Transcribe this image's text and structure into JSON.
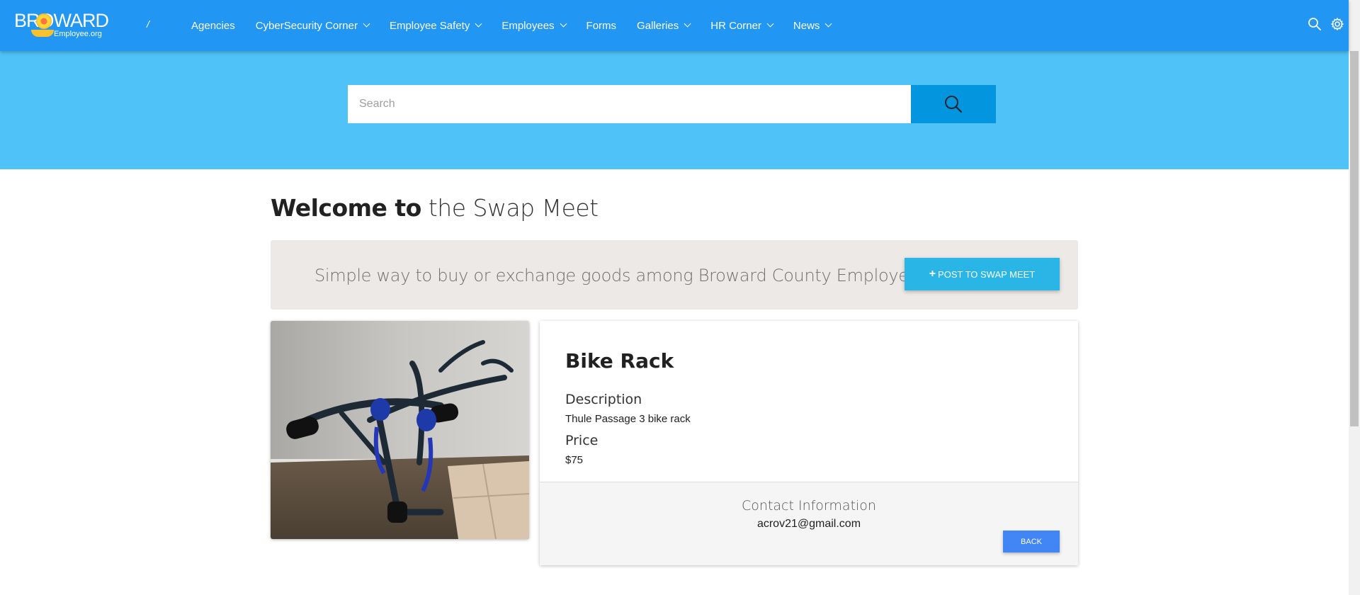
{
  "header": {
    "logo_text": "BROWARD",
    "logo_subtext": "Employee.org",
    "breadcrumb_separator": "/",
    "nav": [
      {
        "label": "Agencies",
        "has_dropdown": false
      },
      {
        "label": "CyberSecurity Corner",
        "has_dropdown": true
      },
      {
        "label": "Employee Safety",
        "has_dropdown": true
      },
      {
        "label": "Employees",
        "has_dropdown": true
      },
      {
        "label": "Forms",
        "has_dropdown": false
      },
      {
        "label": "Galleries",
        "has_dropdown": true
      },
      {
        "label": "HR Corner",
        "has_dropdown": true
      },
      {
        "label": "News",
        "has_dropdown": true
      }
    ],
    "icons": [
      "search-icon",
      "gear-icon"
    ]
  },
  "search": {
    "placeholder": "Search",
    "button_icon": "search-icon"
  },
  "main": {
    "welcome_bold": "Welcome to",
    "welcome_light": "the Swap Meet",
    "banner_text": "Simple way to buy or exchange goods among Broward County Employees",
    "post_button_icon": "+",
    "post_button_label": "POST TO SWAP MEET"
  },
  "listing": {
    "title": "Bike Rack",
    "description_label": "Description",
    "description": "Thule Passage 3 bike rack",
    "price_label": "Price",
    "price": "$75",
    "contact_label": "Contact Information",
    "contact_email": "acrov21@gmail.com",
    "back_label": "BACK",
    "photo": "bike-rack-photo"
  },
  "colors": {
    "navbar": "#2196f3",
    "hero": "#4fc3f7",
    "search_button": "#0395de",
    "post_button": "#29b6e6",
    "back_button": "#4285f4",
    "banner_bg": "#ede9e6"
  }
}
